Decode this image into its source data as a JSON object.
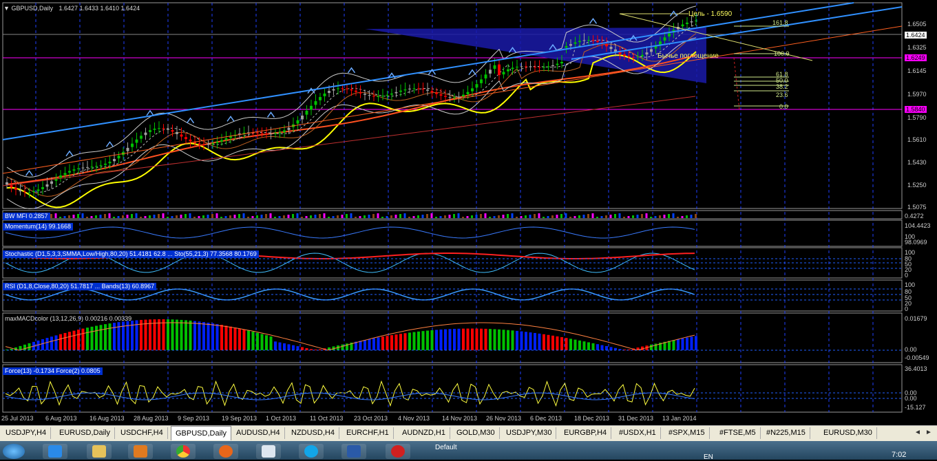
{
  "main_chart": {
    "title": "GBPUSD,Daily",
    "ohlc": "1.6427 1.6433 1.6410 1.6424",
    "target_label": "Цель - 1.6590",
    "pattern_label": "Бычье поглощение",
    "price_axis": [
      "1.6505",
      "1.6325",
      "1.6145",
      "1.5970",
      "1.5790",
      "1.5610",
      "1.5430",
      "1.5250",
      "1.5075"
    ],
    "current_price": "1.6424",
    "magenta_level_top": "1.6249",
    "magenta_level_bottom": "1.5840",
    "fib_levels": [
      "161.8",
      "100.0",
      "61.8",
      "50.0",
      "38.2",
      "23.6",
      "0.0"
    ]
  },
  "indicators": {
    "bw_mfi": {
      "label": "BW MFI 0.2857",
      "axis": "0.4272"
    },
    "momentum": {
      "label": "Momentum(14) 99.1668",
      "axis_top": "104.4423",
      "axis_mid": "100",
      "axis_bottom": "98.0969"
    },
    "stochastic": {
      "label": "Stochastic (D1,5,3,3,SMMA,Low/High,80,20) 51.4181 62.8 ... Sto(55,21,3) 77.3568 80.1769",
      "axis": [
        "100",
        "80",
        "50",
        "20",
        "0"
      ]
    },
    "rsi": {
      "label": "RSI (D1,8,Close,80,20) 51.7817 ... Bands(13) 60.8967",
      "axis": [
        "100",
        "80",
        "50",
        "20",
        "0"
      ]
    },
    "macd": {
      "label": "maxMACDcolor (13,12,26,9) 0.00216 0.00339",
      "axis_top": "0.01679",
      "axis_zero": "0.00",
      "axis_bottom": "-0.00549"
    },
    "force": {
      "label": "Force(13) -0.1734   Force(2) 0.0805",
      "axis_top": "36.4013",
      "axis_mid1": "0.00",
      "axis_mid2": "0.00",
      "axis_bottom": "-15.127"
    }
  },
  "date_axis": [
    "25 Jul 2013",
    "6 Aug 2013",
    "16 Aug 2013",
    "28 Aug 2013",
    "9 Sep 2013",
    "19 Sep 2013",
    "1 Oct 2013",
    "11 Oct 2013",
    "23 Oct 2013",
    "4 Nov 2013",
    "14 Nov 2013",
    "26 Nov 2013",
    "6 Dec 2013",
    "18 Dec 2013",
    "31 Dec 2013",
    "13 Jan 2014"
  ],
  "tabs": [
    "USDJPY,H4",
    "EURUSD,Daily",
    "USDCHF,H4",
    "GBPUSD,Daily",
    "AUDUSD,H4",
    "NZDUSD,H4",
    "EURCHF,H1",
    "AUDNZD,H1",
    "GOLD,M30",
    "USDJPY,M30",
    "EURGBP,H4",
    "#USDX,H1",
    "#SPX,M15",
    "#FTSE,M5",
    "#N225,M15",
    "EURUSD,M30"
  ],
  "active_tab": "GBPUSD,Daily",
  "taskbar": {
    "language": "EN",
    "clock": "7:02",
    "status_text": "Default"
  },
  "colors": {
    "background": "#000000",
    "bull_candle": "#00c000",
    "bear_candle": "#ff0000",
    "neutral_candle": "#a0a0a0",
    "ma_yellow": "#ffff00",
    "ma_orange": "#ff5020",
    "trendline_blue": "#3090ff",
    "magenta": "#ff00ff",
    "panel_label_bg": "#0030d0"
  }
}
